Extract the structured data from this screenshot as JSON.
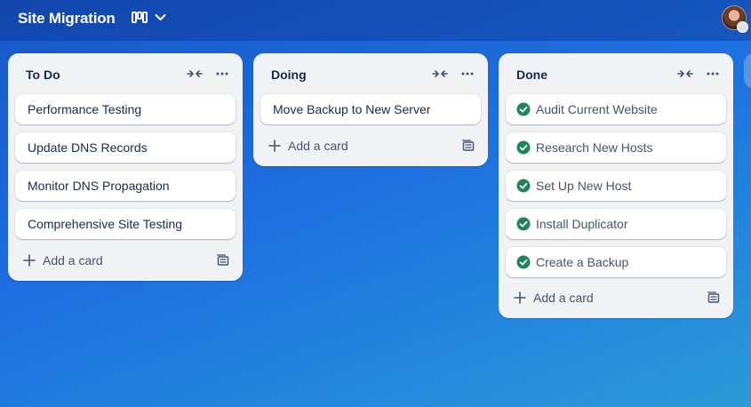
{
  "board": {
    "title": "Site Migration",
    "view_icon": "board-view-icon",
    "switcher_icon": "chevron-down-icon"
  },
  "user": {
    "avatar_icon": "avatar"
  },
  "lists": [
    {
      "title": "To Do",
      "cards": [
        {
          "title": "Performance Testing"
        },
        {
          "title": "Update DNS Records"
        },
        {
          "title": "Monitor DNS Propagation"
        },
        {
          "title": "Comprehensive Site Testing"
        }
      ],
      "add_label": "Add a card"
    },
    {
      "title": "Doing",
      "cards": [
        {
          "title": "Move Backup to New Server"
        }
      ],
      "add_label": "Add a card"
    },
    {
      "title": "Done",
      "cards": [
        {
          "title": "Audit Current Website",
          "complete": true
        },
        {
          "title": "Research New Hosts",
          "complete": true
        },
        {
          "title": "Set Up New Host",
          "complete": true
        },
        {
          "title": "Install Duplicator",
          "complete": true
        },
        {
          "title": "Create a Backup",
          "complete": true
        }
      ],
      "add_label": "Add a card"
    }
  ],
  "colors": {
    "complete_green": "#1f845a",
    "list_bg": "#f1f2f4",
    "text": "#172b4d"
  }
}
